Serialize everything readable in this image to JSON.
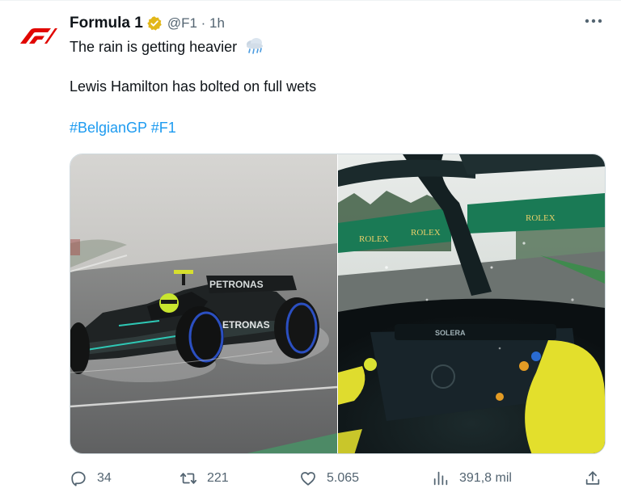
{
  "tweet": {
    "author_name": "Formula 1",
    "handle_time": "@F1 · 1h",
    "line1_text": "The rain is getting heavier",
    "line2_text": "Lewis Hamilton has bolted on full wets",
    "hashtags": [
      "#BelgianGP",
      "#F1"
    ],
    "emoji_icon": "rain-cloud-icon",
    "brand_color": "#e10600",
    "hashtag_color": "#1d9bf0",
    "verified_color": "#e2b719"
  },
  "media": {
    "left_car_sponsor": "PETRONAS",
    "right_board_text": "ROLEX",
    "right_steering_text": "SOLERA"
  },
  "actions": {
    "replies": "34",
    "reposts": "221",
    "likes": "5.065",
    "views": "391,8 mil"
  }
}
